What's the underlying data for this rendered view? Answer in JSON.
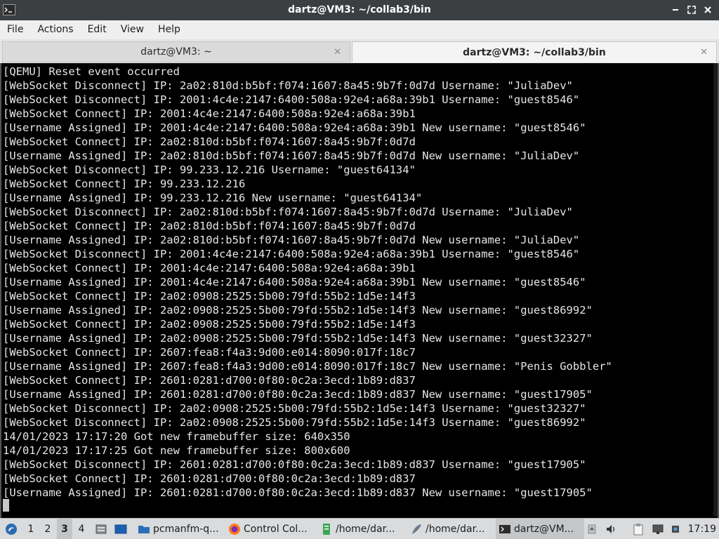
{
  "window": {
    "title": "dartz@VM3: ~/collab3/bin",
    "controls": [
      "minimize",
      "maximize",
      "close"
    ]
  },
  "menu": [
    "File",
    "Actions",
    "Edit",
    "View",
    "Help"
  ],
  "tabs": [
    {
      "label": "dartz@VM3: ~",
      "active": false
    },
    {
      "label": "dartz@VM3: ~/collab3/bin",
      "active": true
    }
  ],
  "terminal": {
    "lines": [
      "[QEMU] Reset event occurred",
      "[WebSocket Disconnect] IP: 2a02:810d:b5bf:f074:1607:8a45:9b7f:0d7d Username: \"JuliaDev\"",
      "[WebSocket Disconnect] IP: 2001:4c4e:2147:6400:508a:92e4:a68a:39b1 Username: \"guest8546\"",
      "[WebSocket Connect] IP: 2001:4c4e:2147:6400:508a:92e4:a68a:39b1",
      "[Username Assigned] IP: 2001:4c4e:2147:6400:508a:92e4:a68a:39b1 New username: \"guest8546\"",
      "[WebSocket Connect] IP: 2a02:810d:b5bf:f074:1607:8a45:9b7f:0d7d",
      "[Username Assigned] IP: 2a02:810d:b5bf:f074:1607:8a45:9b7f:0d7d New username: \"JuliaDev\"",
      "[WebSocket Disconnect] IP: 99.233.12.216 Username: \"guest64134\"",
      "[WebSocket Connect] IP: 99.233.12.216",
      "[Username Assigned] IP: 99.233.12.216 New username: \"guest64134\"",
      "[WebSocket Disconnect] IP: 2a02:810d:b5bf:f074:1607:8a45:9b7f:0d7d Username: \"JuliaDev\"",
      "[WebSocket Connect] IP: 2a02:810d:b5bf:f074:1607:8a45:9b7f:0d7d",
      "[Username Assigned] IP: 2a02:810d:b5bf:f074:1607:8a45:9b7f:0d7d New username: \"JuliaDev\"",
      "[WebSocket Disconnect] IP: 2001:4c4e:2147:6400:508a:92e4:a68a:39b1 Username: \"guest8546\"",
      "[WebSocket Connect] IP: 2001:4c4e:2147:6400:508a:92e4:a68a:39b1",
      "[Username Assigned] IP: 2001:4c4e:2147:6400:508a:92e4:a68a:39b1 New username: \"guest8546\"",
      "[WebSocket Connect] IP: 2a02:0908:2525:5b00:79fd:55b2:1d5e:14f3",
      "[Username Assigned] IP: 2a02:0908:2525:5b00:79fd:55b2:1d5e:14f3 New username: \"guest86992\"",
      "[WebSocket Connect] IP: 2a02:0908:2525:5b00:79fd:55b2:1d5e:14f3",
      "[Username Assigned] IP: 2a02:0908:2525:5b00:79fd:55b2:1d5e:14f3 New username: \"guest32327\"",
      "[WebSocket Connect] IP: 2607:fea8:f4a3:9d00:e014:8090:017f:18c7",
      "[Username Assigned] IP: 2607:fea8:f4a3:9d00:e014:8090:017f:18c7 New username: \"Penis Gobbler\"",
      "[WebSocket Connect] IP: 2601:0281:d700:0f80:0c2a:3ecd:1b89:d837",
      "[Username Assigned] IP: 2601:0281:d700:0f80:0c2a:3ecd:1b89:d837 New username: \"guest17905\"",
      "[WebSocket Disconnect] IP: 2a02:0908:2525:5b00:79fd:55b2:1d5e:14f3 Username: \"guest32327\"",
      "[WebSocket Disconnect] IP: 2a02:0908:2525:5b00:79fd:55b2:1d5e:14f3 Username: \"guest86992\"",
      "14/01/2023 17:17:20 Got new framebuffer size: 640x350",
      "14/01/2023 17:17:25 Got new framebuffer size: 800x600",
      "[WebSocket Disconnect] IP: 2601:0281:d700:0f80:0c2a:3ecd:1b89:d837 Username: \"guest17905\"",
      "[WebSocket Connect] IP: 2601:0281:d700:0f80:0c2a:3ecd:1b89:d837",
      "[Username Assigned] IP: 2601:0281:d700:0f80:0c2a:3ecd:1b89:d837 New username: \"guest17905\""
    ]
  },
  "taskbar": {
    "workspaces": [
      "1",
      "2",
      "3",
      "4"
    ],
    "active_workspace": "3",
    "tasks": [
      {
        "label": "pcmanfm-q...",
        "icon": "folder-icon"
      },
      {
        "label": "Control Col...",
        "icon": "firefox-icon"
      },
      {
        "label": "/home/dar...",
        "icon": "text-editor-icon"
      },
      {
        "label": "/home/dar...",
        "icon": "feather-editor-icon"
      },
      {
        "label": "dartz@VM...",
        "icon": "terminal-icon"
      }
    ],
    "clock": "17:19"
  },
  "colors": {
    "titlebar": "#3c3f41",
    "terminal_bg": "#000000",
    "terminal_fg": "#e6e6e6",
    "taskbar": "#d9dbdd"
  }
}
